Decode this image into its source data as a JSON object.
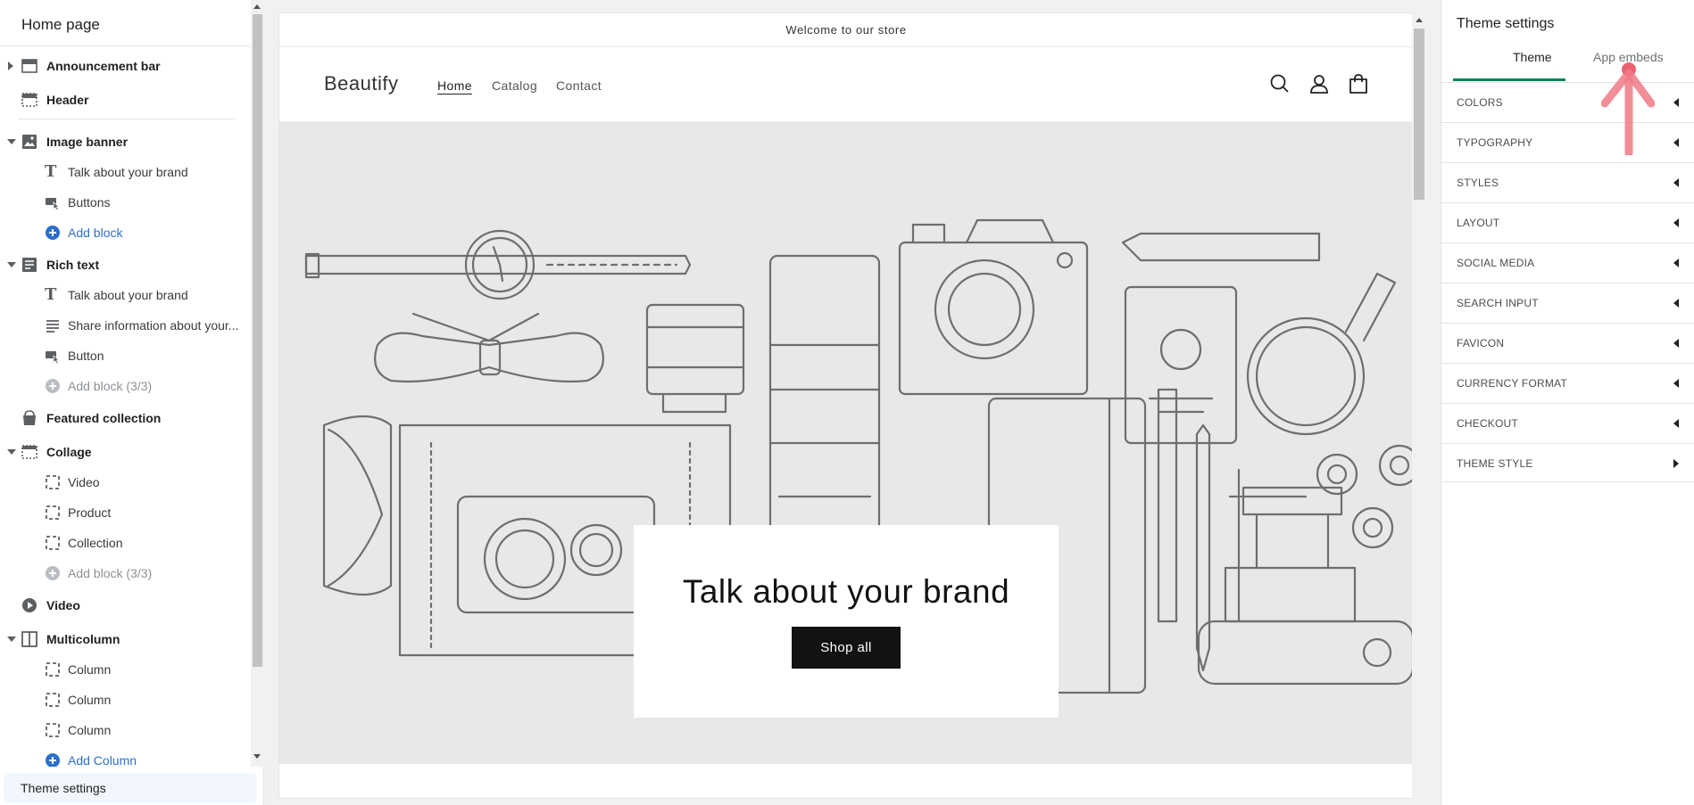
{
  "left_panel": {
    "title": "Home page",
    "sections": [
      {
        "label": "Announcement bar",
        "icon": "section-icon",
        "caret": "right"
      },
      {
        "label": "Header",
        "icon": "section-icon",
        "caret": "none"
      },
      {
        "label": "Image banner",
        "icon": "image-icon",
        "caret": "down"
      },
      {
        "label": "Rich text",
        "icon": "text-block-icon",
        "caret": "down"
      },
      {
        "label": "Featured collection",
        "icon": "tag-icon",
        "caret": "none"
      },
      {
        "label": "Collage",
        "icon": "collage-icon",
        "caret": "down"
      },
      {
        "label": "Video",
        "icon": "play-icon",
        "caret": "none"
      },
      {
        "label": "Multicolumn",
        "icon": "columns-icon",
        "caret": "down"
      }
    ],
    "blocks": {
      "image_banner": [
        "Talk about your brand",
        "Buttons",
        "Add block"
      ],
      "rich_text": [
        "Talk about your brand",
        "Share information about your...",
        "Button",
        "Add block (3/3)"
      ],
      "collage": [
        "Video",
        "Product",
        "Collection",
        "Add block (3/3)"
      ],
      "multicolumn": [
        "Column",
        "Column",
        "Column",
        "Add Column"
      ]
    },
    "footer_button": "Theme settings"
  },
  "preview": {
    "announcement": "Welcome to our store",
    "brand": "Beautify",
    "nav": [
      "Home",
      "Catalog",
      "Contact"
    ],
    "header_icons": [
      "search-icon",
      "account-icon",
      "cart-icon"
    ],
    "banner_title": "Talk about your brand",
    "banner_button": "Shop all"
  },
  "right_panel": {
    "title": "Theme settings",
    "tabs": [
      "Theme",
      "App embeds"
    ],
    "active_tab": "Theme",
    "settings": [
      "COLORS",
      "TYPOGRAPHY",
      "STYLES",
      "LAYOUT",
      "SOCIAL MEDIA",
      "SEARCH INPUT",
      "FAVICON",
      "CURRENCY FORMAT",
      "CHECKOUT",
      "THEME STYLE"
    ]
  },
  "colors": {
    "accent_green": "#008060",
    "link_blue": "#2c6ecb",
    "annotation_arrow": "#f07a85"
  }
}
